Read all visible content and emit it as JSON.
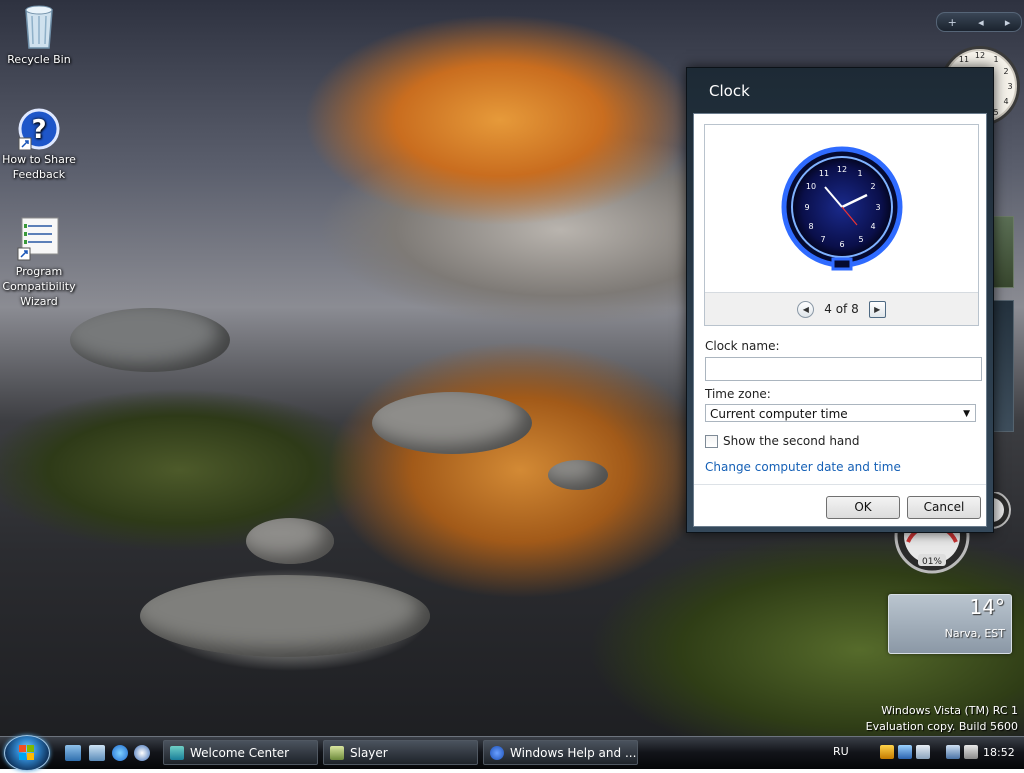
{
  "desktop": {
    "icons": [
      {
        "label": "Recycle Bin",
        "icon": "recycle-bin-icon"
      },
      {
        "label": "How to Share Feedback",
        "icon": "help-icon"
      },
      {
        "label": "Program Compatibility Wizard",
        "icon": "compatibility-wizard-icon"
      }
    ]
  },
  "sidebar": {
    "controls": {
      "add": "+",
      "prev": "◂",
      "next": "▸"
    },
    "weather": {
      "temperature": "14°",
      "location": "Narva, EST"
    },
    "cpu_meter": {
      "value": "01%"
    }
  },
  "dialog": {
    "title": "Clock",
    "pager": {
      "text": "4 of 8"
    },
    "clock_name_label": "Clock name:",
    "clock_name_value": "",
    "time_zone_label": "Time zone:",
    "time_zone_value": "Current computer time",
    "second_hand_label": "Show the second hand",
    "second_hand_checked": false,
    "change_link": "Change computer date and time",
    "ok": "OK",
    "cancel": "Cancel"
  },
  "watermark": {
    "line1": "Windows Vista (TM) RC 1",
    "line2": "Evaluation copy. Build 5600"
  },
  "taskbar": {
    "tasks": [
      {
        "label": "Welcome Center",
        "icon": "welcome-center-icon"
      },
      {
        "label": "Slayer",
        "icon": "folder-icon"
      },
      {
        "label": "Windows Help and ...",
        "icon": "help-icon"
      }
    ],
    "language": "RU",
    "clock": "18:52"
  },
  "colors": {
    "accent_link": "#1560b6",
    "dialog_frame": "#1d2a35",
    "taskbar": "#121419"
  }
}
